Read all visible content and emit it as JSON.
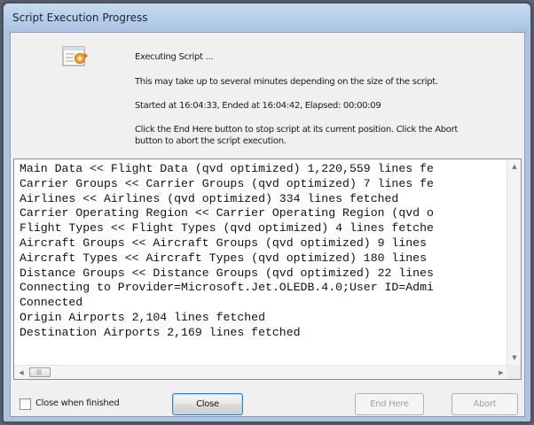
{
  "window": {
    "title": "Script Execution Progress"
  },
  "info": {
    "icon": "script-icon",
    "status": "Executing Script ...",
    "note": "This may take up to several minutes depending on the size of the script.",
    "timing": "Started at 16:04:33, Ended at 16:04:42,  Elapsed: 00:00:09",
    "instruction_line1": "Click the End Here button to stop script at its current position. Click the Abort",
    "instruction_line2": "button to abort the script execution."
  },
  "log": {
    "lines": [
      "Main Data << Flight Data (qvd optimized) 1,220,559 lines fe",
      "Carrier Groups << Carrier Groups (qvd optimized) 7 lines fe",
      "Airlines << Airlines (qvd optimized) 334 lines fetched",
      "Carrier Operating Region << Carrier Operating Region (qvd o",
      "Flight Types << Flight Types (qvd optimized) 4 lines fetche",
      "Aircraft Groups << Aircraft Groups (qvd optimized) 9 lines ",
      "Aircraft Types << Aircraft Types (qvd optimized) 180 lines ",
      "Distance Groups << Distance Groups (qvd optimized) 22 lines",
      "Connecting to Provider=Microsoft.Jet.OLEDB.4.0;User ID=Admi",
      "Connected",
      "Origin Airports 2,104 lines fetched",
      "Destination Airports 2,169 lines fetched"
    ]
  },
  "footer": {
    "close_when_finished_label": "Close when finished",
    "close_when_finished_checked": false,
    "close_button": "Close",
    "end_here_button": "End Here",
    "abort_button": "Abort"
  },
  "colors": {
    "title_bar": "#aec4de",
    "dialog_bg": "#f0f0f0",
    "default_button_border": "#3c7fb1"
  }
}
